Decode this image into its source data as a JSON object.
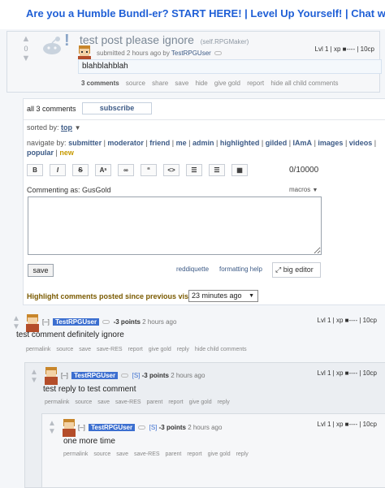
{
  "banner": {
    "text": "Are you a Humble Bundl-er? START HERE! | Level Up Yourself! | Chat with Makers"
  },
  "post": {
    "score": "0",
    "title": "test post please ignore",
    "domain": "(self.RPGMaker)",
    "level": "Lvl 1 | xp ■---- | 10cp",
    "tagline_pre": "submitted 2 hours ago by",
    "author": "TestRPGUser",
    "selftext": "blahblahblah",
    "buttons": {
      "comments": "3 comments",
      "source": "source",
      "share": "share",
      "save": "save",
      "hide": "hide",
      "give_gold": "give gold",
      "report": "report",
      "hide_child": "hide all child comments"
    }
  },
  "comment_area": {
    "count": "all 3 comments",
    "subscribe": "subscribe",
    "sorted_label": "sorted by:",
    "sorted_value": "top",
    "navigate_label": "navigate by:",
    "navigate_items": [
      "submitter",
      "moderator",
      "friend",
      "me",
      "admin",
      "highlighted",
      "gilded",
      "IAmA",
      "images",
      "videos",
      "popular",
      "new"
    ],
    "toolbar": {
      "bold": "B",
      "italic": "I",
      "strike": "S",
      "super": "Aˢ",
      "link": "∞",
      "quote": "“",
      "code": "<>",
      "bullets": "☰",
      "numbers": "☰",
      "table": "▦"
    },
    "char_counter": "0/10000",
    "commenting_as": "Commenting as: GusGold",
    "macros": "macros",
    "textbox_value": "",
    "save": "save",
    "reddiquette": "reddiquette",
    "formatting_help": "formatting help",
    "big_editor": "big editor",
    "highlight_label": "Highlight comments posted since previous visit:",
    "highlight_value": "23 minutes ago"
  },
  "comments": [
    {
      "toggle": "[–]",
      "author": "TestRPGUser",
      "points": "-3 points",
      "time": "2 hours ago",
      "level": "Lvl 1 | xp ■---- | 10cp",
      "body": "test comment definitely ignore",
      "buttons": [
        "permalink",
        "source",
        "save",
        "save-RES",
        "report",
        "give gold",
        "reply",
        "hide child comments"
      ]
    },
    {
      "toggle": "[–]",
      "author": "TestRPGUser",
      "mark": "[S]",
      "points": "-3 points",
      "time": "2 hours ago",
      "level": "Lvl 1 | xp ■---- | 10cp",
      "body": "test reply to test comment",
      "buttons": [
        "permalink",
        "source",
        "save",
        "save-RES",
        "parent",
        "report",
        "give gold",
        "reply"
      ]
    },
    {
      "toggle": "[–]",
      "author": "TestRPGUser",
      "mark": "[S]",
      "points": "-3 points",
      "time": "2 hours ago",
      "level": "Lvl 1 | xp ■---- | 10cp",
      "body": "one more time",
      "buttons": [
        "permalink",
        "source",
        "save",
        "save-RES",
        "parent",
        "report",
        "give gold",
        "reply"
      ]
    }
  ],
  "colors": {
    "banner_text": "#1f5fd6",
    "user_badge": "#3c6fd0",
    "link": "#3c5a86",
    "highlight": "#7a5a00"
  }
}
